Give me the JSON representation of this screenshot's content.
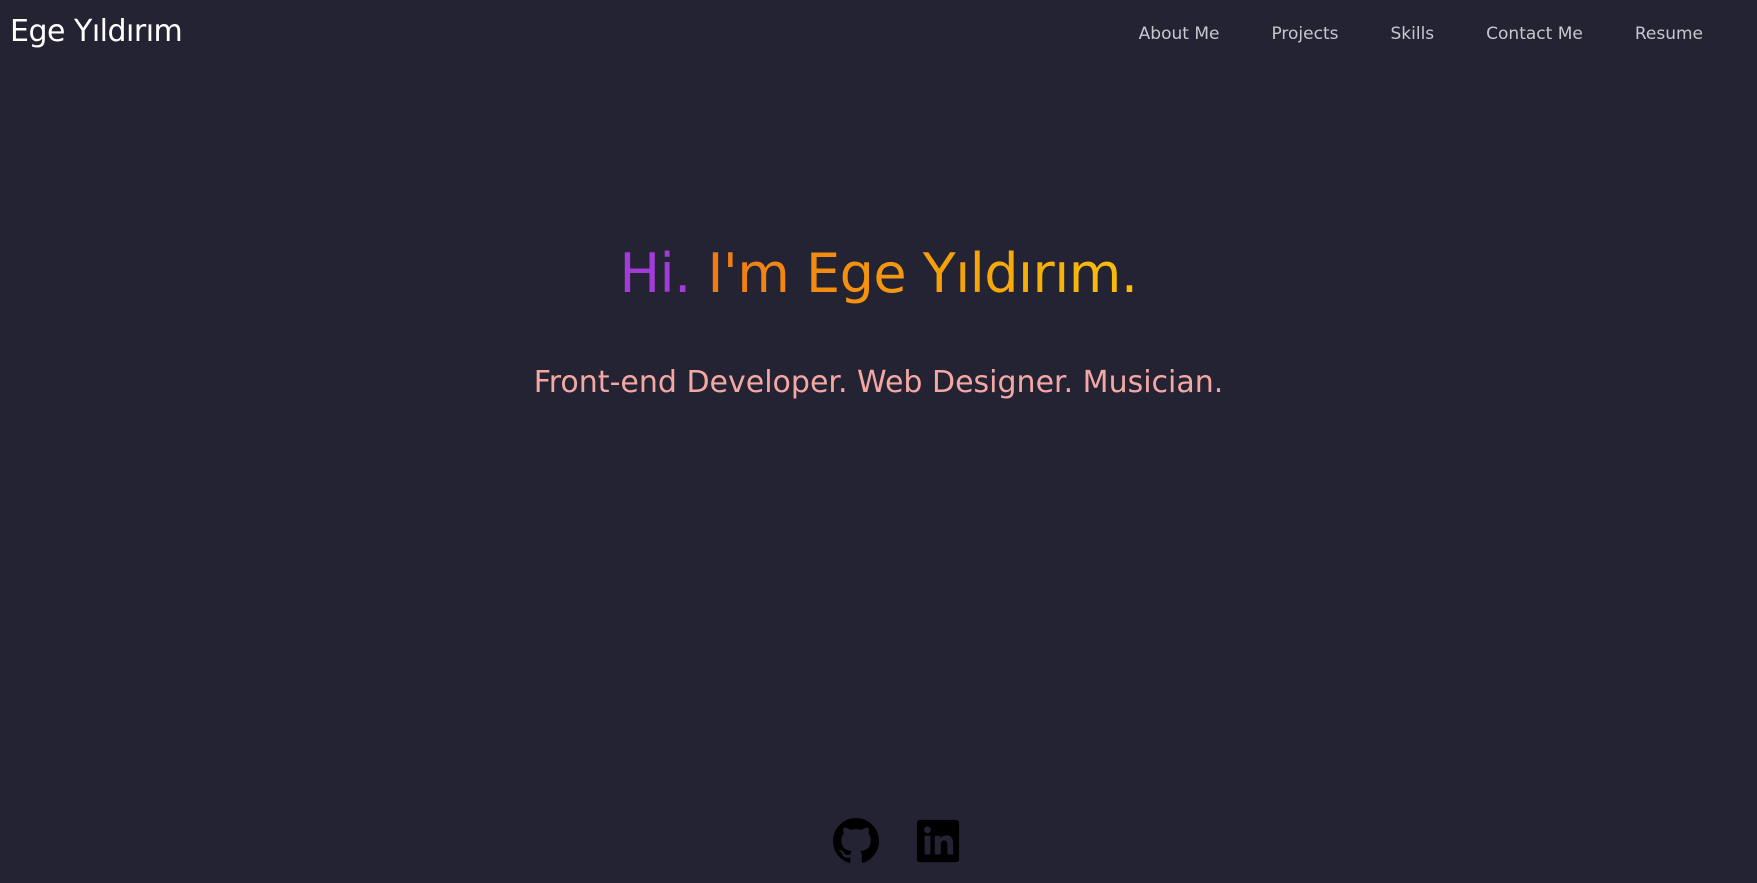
{
  "header": {
    "brand": "Ege Yıldırım",
    "nav": [
      {
        "label": "About Me"
      },
      {
        "label": "Projects"
      },
      {
        "label": "Skills"
      },
      {
        "label": "Contact Me"
      },
      {
        "label": "Resume"
      }
    ]
  },
  "hero": {
    "title_hi": "Hi.",
    "title_rest": "I'm Ege Yıldırım.",
    "subtitle": "Front-end Developer. Web Designer. Musician."
  },
  "socials": [
    {
      "icon": "github-icon"
    },
    {
      "icon": "linkedin-icon"
    }
  ],
  "colors": {
    "background": "#242333",
    "brand": "#ffffff",
    "nav_text": "#c7c7cc",
    "hi": "#a23bd8",
    "name_gradient": [
      "#f07a14",
      "#f8bf0a"
    ],
    "subtitle": "#f4a8a3",
    "icons": "#000000"
  }
}
